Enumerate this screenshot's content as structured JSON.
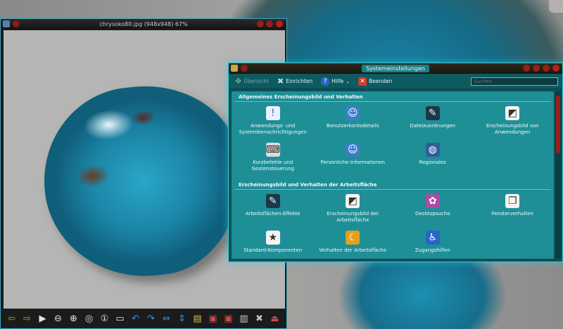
{
  "viewer": {
    "title": "chrysoko80.jpg (948x948) 67%",
    "toolbar": [
      {
        "name": "back-icon",
        "glyph": "⇦",
        "color": "#6ec13a"
      },
      {
        "name": "forward-icon",
        "glyph": "⇨",
        "color": "#6ec13a"
      },
      {
        "name": "play-icon",
        "glyph": "▶",
        "color": "#e6e6e6"
      },
      {
        "name": "zoom-out-icon",
        "glyph": "⊖",
        "color": "#e6e6e6"
      },
      {
        "name": "zoom-in-icon",
        "glyph": "⊕",
        "color": "#e6e6e6"
      },
      {
        "name": "zoom-fit-icon",
        "glyph": "◎",
        "color": "#e6e6e6"
      },
      {
        "name": "zoom-original-icon",
        "glyph": "①",
        "color": "#e6e6e6"
      },
      {
        "name": "fullscreen-icon",
        "glyph": "▭",
        "color": "#e6e6e6"
      },
      {
        "name": "rotate-left-icon",
        "glyph": "↶",
        "color": "#3a8ee8"
      },
      {
        "name": "rotate-right-icon",
        "glyph": "↷",
        "color": "#3a8ee8"
      },
      {
        "name": "flip-horizontal-icon",
        "glyph": "⇔",
        "color": "#3a8ee8"
      },
      {
        "name": "flip-vertical-icon",
        "glyph": "⇕",
        "color": "#3a8ee8"
      },
      {
        "name": "open-folder-icon",
        "glyph": "▤",
        "color": "#d9b860"
      },
      {
        "name": "save-icon",
        "glyph": "▣",
        "color": "#d24a4a"
      },
      {
        "name": "save-as-icon",
        "glyph": "▣",
        "color": "#d24a4a"
      },
      {
        "name": "delete-icon",
        "glyph": "▥",
        "color": "#c8c8c8"
      },
      {
        "name": "settings-icon",
        "glyph": "✖",
        "color": "#bfbfbf"
      },
      {
        "name": "quit-icon",
        "glyph": "⏏",
        "color": "#d24a4a"
      }
    ]
  },
  "settings": {
    "title": "Systemeinstellungen",
    "toolbar": {
      "overview": "Übersicht",
      "configure": "Einrichten",
      "help": "Hilfe",
      "quit": "Beenden"
    },
    "search_placeholder": "Suchen",
    "sections": [
      {
        "title": "Allgemeines Erscheinungsbild und Verhalten",
        "items": [
          {
            "label": "Anwendungs- und Systembenachrichtigungen",
            "icon": "notification-icon",
            "glyph": "!",
            "style": "ic-blue"
          },
          {
            "label": "Benutzerkontodetails",
            "icon": "user-account-icon",
            "glyph": "☺",
            "style": "ic-user"
          },
          {
            "label": "Dateizuordnungen",
            "icon": "file-associations-icon",
            "glyph": "✎",
            "style": "ic-dark"
          },
          {
            "label": "Erscheinungsbild von Anwendungen",
            "icon": "application-appearance-icon",
            "glyph": "◩",
            "style": "ic-white"
          },
          {
            "label": "Kurzbefehle und Gestensteuerung",
            "icon": "shortcuts-icon",
            "glyph": "⌨",
            "style": "ic-kbd"
          },
          {
            "label": "Persönliche Informationen",
            "icon": "personal-info-icon",
            "glyph": "☺",
            "style": "ic-user"
          },
          {
            "label": "Regionales",
            "icon": "regional-icon",
            "glyph": "◍",
            "style": "ic-globe"
          }
        ]
      },
      {
        "title": "Erscheinungsbild und Verhalten der Arbeitsfläche",
        "items": [
          {
            "label": "Arbeitsflächen-Effekte",
            "icon": "desktop-effects-icon",
            "glyph": "✎",
            "style": "ic-dark"
          },
          {
            "label": "Erscheinungsbild der Arbeitsfläche",
            "icon": "desktop-appearance-icon",
            "glyph": "◩",
            "style": "ic-white"
          },
          {
            "label": "Desktopsuche",
            "icon": "desktop-search-icon",
            "glyph": "✿",
            "style": "ic-pink"
          },
          {
            "label": "Fensterverhalten",
            "icon": "window-behavior-icon",
            "glyph": "❐",
            "style": "ic-white"
          },
          {
            "label": "Standard-Komponenten",
            "icon": "default-components-icon",
            "glyph": "★",
            "style": "ic-white"
          },
          {
            "label": "Verhalten der Arbeitsfläche",
            "icon": "workspace-behavior-icon",
            "glyph": "☾",
            "style": "ic-yellow"
          },
          {
            "label": "Zugangshilfen",
            "icon": "accessibility-icon",
            "glyph": "♿",
            "style": "ic-access"
          }
        ]
      }
    ]
  }
}
